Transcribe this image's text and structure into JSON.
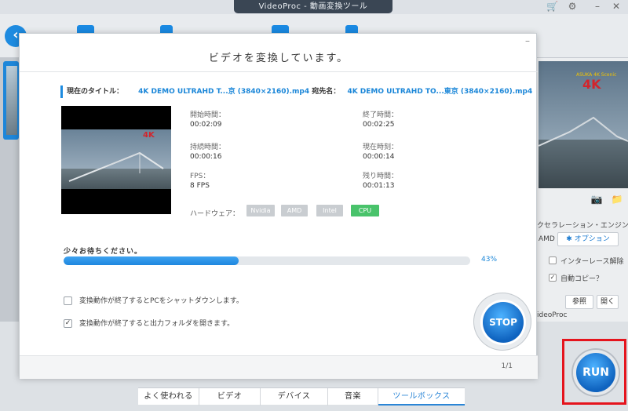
{
  "app": {
    "title": "VideoProc - 動画変換ツール"
  },
  "titlebar": {
    "cart_icon": "cart-icon",
    "gear_icon": "gear-icon",
    "minimize_icon": "minimize-icon",
    "close_icon": "close-icon"
  },
  "dialog": {
    "heading": "ビデオを変換しています。",
    "current_title_label": "現在のタイトル：",
    "current_title_value": "4K DEMO ULTRAHD T...京 (3840×2160).mp4",
    "dest_label": "宛先名：",
    "dest_value": "4K DEMO ULTRAHD TO...東京 (3840×2160).mp4",
    "stats": {
      "start_label": "開始時間：",
      "start_value": "00:02:09",
      "end_label": "終了時間：",
      "end_value": "00:02:25",
      "duration_label": "持続時間：",
      "duration_value": "00:00:16",
      "current_label": "現在時刻：",
      "current_value": "00:00:14",
      "fps_label": "FPS：",
      "fps_value": "8 FPS",
      "remaining_label": "残り時間：",
      "remaining_value": "00:01:13"
    },
    "hardware_label": "ハードウェア：",
    "hardware": [
      "Nvidia",
      "AMD",
      "Intel",
      "CPU"
    ],
    "hardware_active": "CPU",
    "wait_label": "少々お待ちください。",
    "progress_fraction": 0.43,
    "progress_text": "43%",
    "option_shutdown": "変換動作が終了するとPCをシャットダウンします。",
    "option_shutdown_checked": false,
    "option_open_folder": "変換動作が終了すると出力フォルダを開きます。",
    "option_open_folder_checked": true,
    "stop_label": "STOP",
    "page_count": "1/1",
    "thumb_logo": "4K"
  },
  "right_panel": {
    "preview_logo": "4K",
    "preview_logo_small": "ASUKA 4K Scenic",
    "engine_label": "クセラレーション・エンジン：",
    "amd_label": "AMD",
    "option_button": "オプション",
    "deinterlace_label": "インターレース解除",
    "autocopy_label": "自動コピー？",
    "output_partial": "ideoProc",
    "browse_button": "参照",
    "open_button": "開く"
  },
  "tabs": [
    "よく使われる",
    "ビデオ",
    "デバイス",
    "音楽",
    "ツールボックス"
  ],
  "active_tab": "ツールボックス",
  "run_label": "RUN",
  "colors": {
    "accent": "#1d86df",
    "active_chip": "#49c36b",
    "highlight": "#e5141d"
  }
}
